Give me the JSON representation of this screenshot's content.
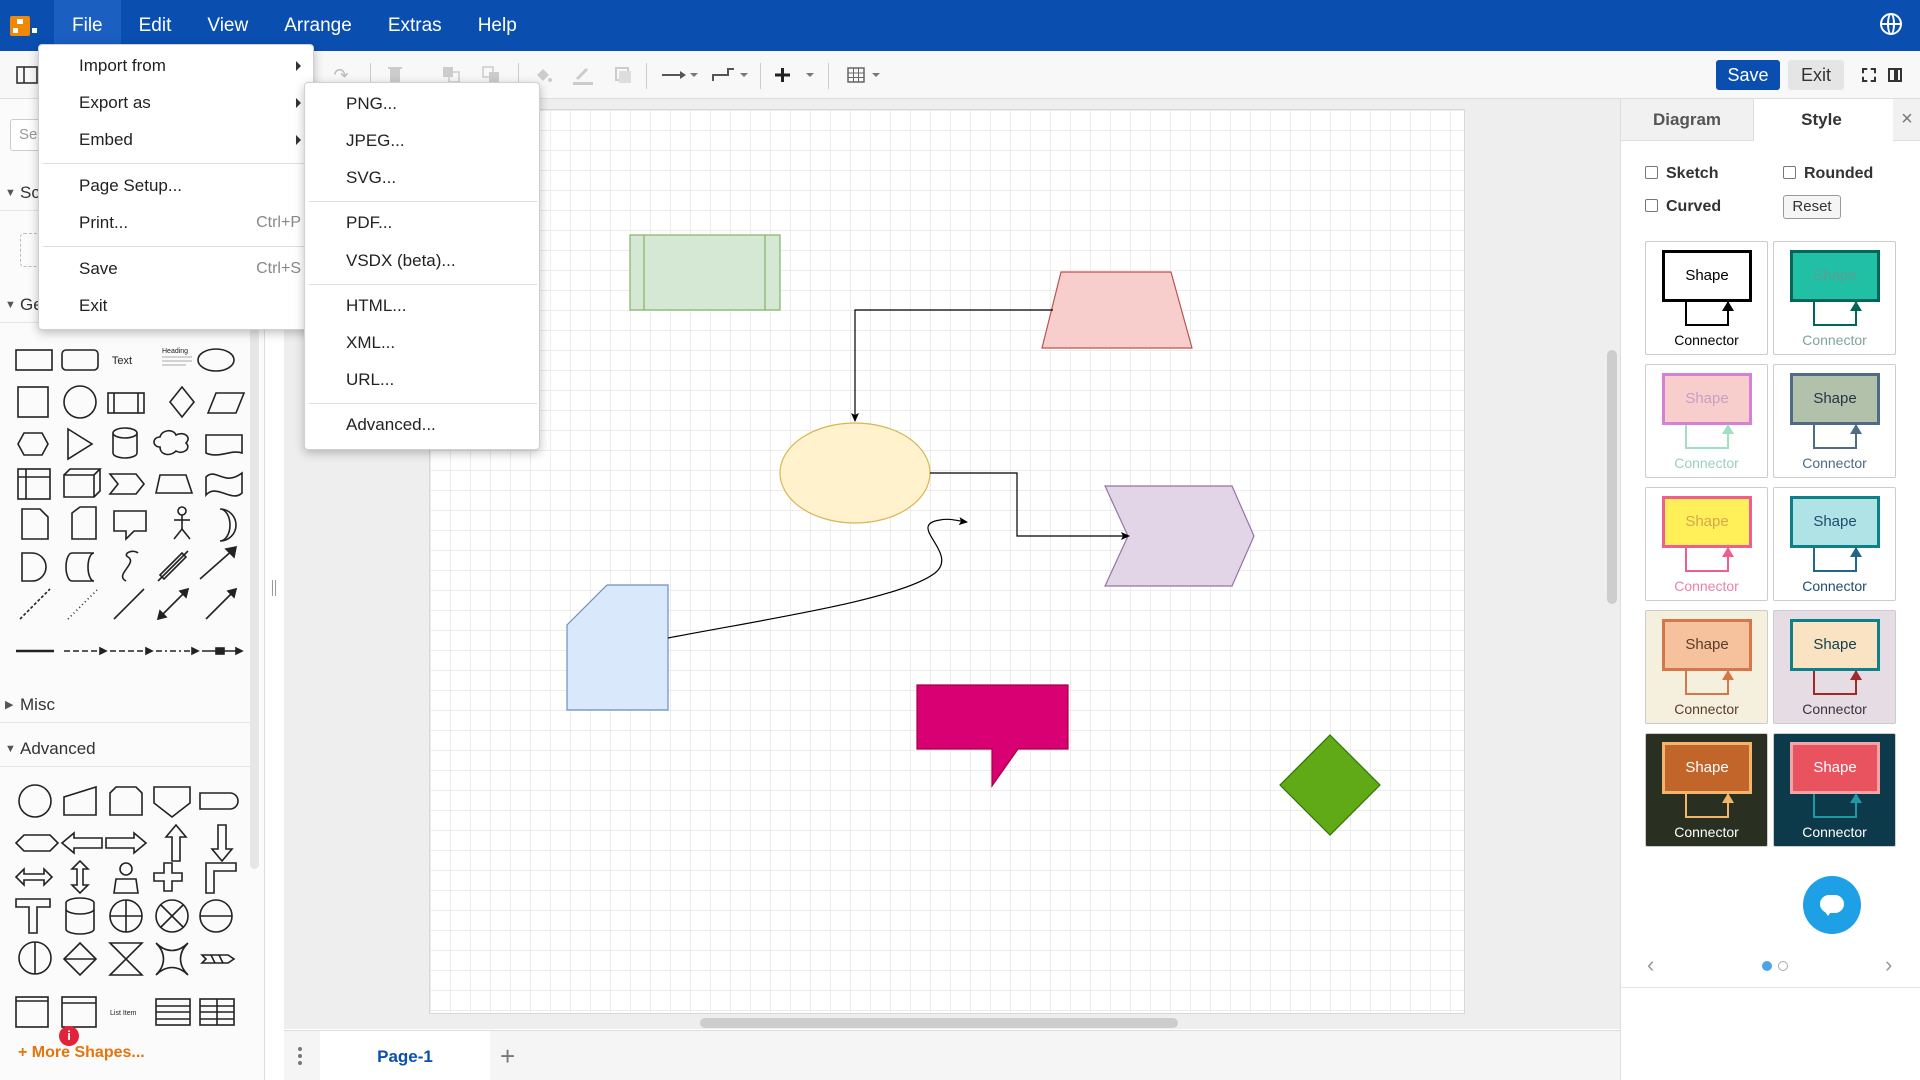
{
  "menubar": {
    "items": [
      "File",
      "Edit",
      "View",
      "Arrange",
      "Extras",
      "Help"
    ]
  },
  "toolbar": {
    "save_label": "Save",
    "exit_label": "Exit"
  },
  "sidebar": {
    "search_placeholder": "Se",
    "sections": {
      "scratchpad": "Sc",
      "general": "Ge",
      "misc": "Misc",
      "advanced": "Advanced"
    },
    "text_shape_label": "Text",
    "heading_shape_label": "Heading",
    "list_item_label": "List Item",
    "more_shapes": "More Shapes..."
  },
  "file_menu": {
    "import_from": "Import from",
    "export_as": "Export as",
    "embed": "Embed",
    "page_setup": "Page Setup...",
    "print": "Print...",
    "print_shortcut": "Ctrl+P",
    "save": "Save",
    "save_shortcut": "Ctrl+S",
    "exit": "Exit"
  },
  "export_menu": {
    "items": [
      "PNG...",
      "JPEG...",
      "SVG...",
      "PDF...",
      "VSDX (beta)...",
      "HTML...",
      "XML...",
      "URL...",
      "Advanced..."
    ]
  },
  "format_panel": {
    "tabs": [
      "Diagram",
      "Style"
    ],
    "close": "×",
    "sketch": "Sketch",
    "rounded": "Rounded",
    "curved": "Curved",
    "reset": "Reset",
    "swatches": [
      {
        "shape": "Shape",
        "connector": "Connector",
        "bg": "#ffffff",
        "fill": "#ffffff",
        "stroke": "#000000",
        "text": "#000000",
        "ctext": "#000000"
      },
      {
        "shape": "Shape",
        "connector": "Connector",
        "bg": "#ffffff",
        "fill": "#21c0a5",
        "stroke": "#006658",
        "text": "#5c9e93",
        "ctext": "#7fa49d"
      },
      {
        "shape": "Shape",
        "connector": "Connector",
        "bg": "#ffffff",
        "fill": "#f8cecc",
        "stroke": "#d680d6",
        "text": "#c79fc7",
        "ctext": "#9bd0bd",
        "cstroke": "#9ee0c0"
      },
      {
        "shape": "Shape",
        "connector": "Connector",
        "bg": "#ffffff",
        "fill": "#b2c1aa",
        "stroke": "#4f6b87",
        "text": "#26364a",
        "ctext": "#4f6b87"
      },
      {
        "shape": "Shape",
        "connector": "Connector",
        "bg": "#ffffff",
        "fill": "#fff05a",
        "stroke": "#ee5e8f",
        "text": "#d6a74d",
        "ctext": "#ee7fa7"
      },
      {
        "shape": "Shape",
        "connector": "Connector",
        "bg": "#ffffff",
        "fill": "#b0e3e6",
        "stroke": "#0e8088",
        "text": "#1d4d6f",
        "ctext": "#1d4d6f",
        "cstroke": "#24658a"
      },
      {
        "shape": "Shape",
        "connector": "Connector",
        "bg": "#f5f0dd",
        "fill": "#f5c29d",
        "stroke": "#d6774b",
        "text": "#5c3b28",
        "ctext": "#5c3b28"
      },
      {
        "shape": "Shape",
        "connector": "Connector",
        "bg": "#e6dce3",
        "fill": "#fae3c3",
        "stroke": "#0e8088",
        "text": "#123f4c",
        "ctext": "#3f2f45",
        "cstroke": "#a1292b"
      },
      {
        "shape": "Shape",
        "connector": "Connector",
        "bg": "#2a3021",
        "fill": "#c1652a",
        "stroke": "#f2b56a",
        "text": "#ffffff",
        "ctext": "#ffffff",
        "cstroke": "#f2b56a"
      },
      {
        "shape": "Shape",
        "connector": "Connector",
        "bg": "#0c3a4b",
        "fill": "#e8535f",
        "stroke": "#f5a5a5",
        "text": "#ffffff",
        "ctext": "#ffffff",
        "cstroke": "#1e98a4"
      }
    ]
  },
  "pages": {
    "tab": "Page-1",
    "add": "+"
  },
  "notifications": {
    "badge": "i"
  }
}
